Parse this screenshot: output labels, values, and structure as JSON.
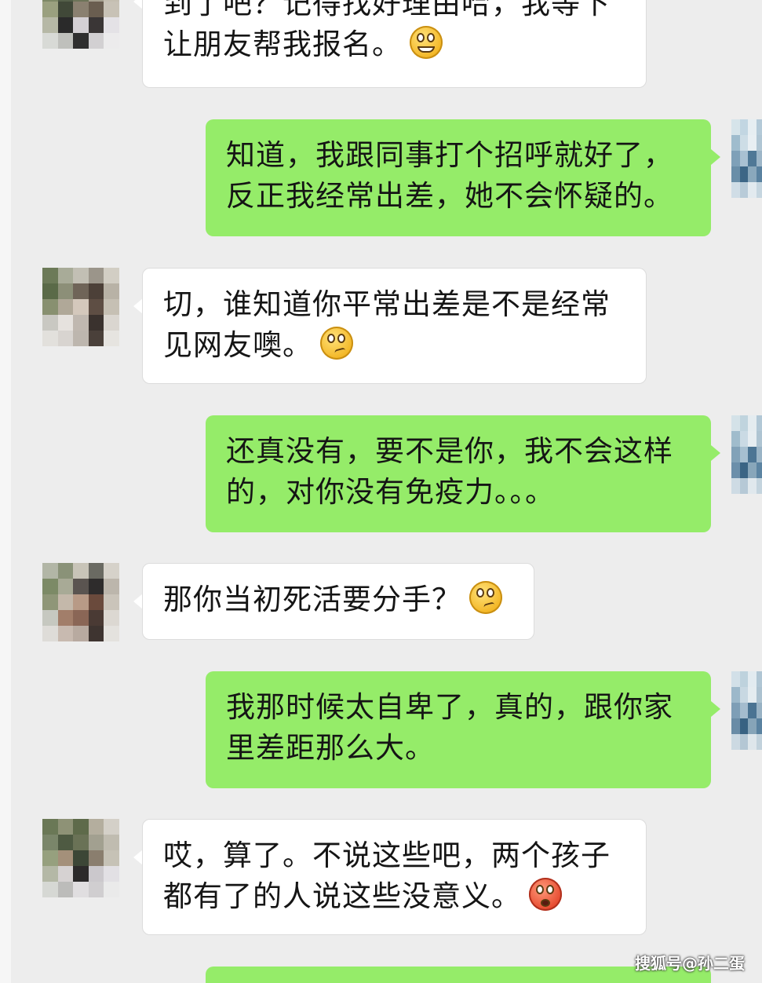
{
  "messages": [
    {
      "side": "left",
      "lines": [
        "到了吧？记得找好理由哈，我等下",
        "让朋友帮我报名。"
      ],
      "emoji": "grinning-emoji"
    },
    {
      "side": "right",
      "lines": [
        "知道，我跟同事打个招呼就好了，",
        "反正我经常出差，她不会怀疑的。"
      ]
    },
    {
      "side": "left",
      "lines": [
        "切，谁知道你平常出差是不是经常",
        "见网友噢。"
      ],
      "emoji": "rolling-eyes-emoji"
    },
    {
      "side": "right",
      "lines": [
        "还真没有，要不是你，我不会这样",
        "的，对你没有免疫力。。。"
      ]
    },
    {
      "side": "left",
      "lines": [
        "那你当初死活要分手？"
      ],
      "emoji": "rolling-eyes-emoji"
    },
    {
      "side": "right",
      "lines": [
        "我那时候太自卑了，真的，跟你家",
        "里差距那么大。"
      ]
    },
    {
      "side": "left",
      "lines": [
        "哎，算了。不说这些吧，两个孩子",
        "都有了的人说这些没意义。"
      ],
      "emoji": "flushed-emoji"
    }
  ],
  "watermark": "搜狐号@孙二蛋",
  "colors": {
    "background": "#ededed",
    "sent_bubble": "#95ec69",
    "received_bubble": "#ffffff"
  }
}
